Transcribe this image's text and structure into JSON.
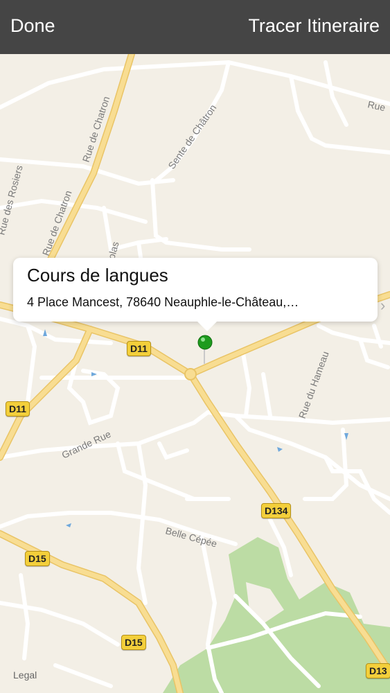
{
  "navbar": {
    "left_button": "Done",
    "right_button": "Tracer Itineraire"
  },
  "callout": {
    "title": "Cours de langues",
    "address": "4 Place Mancest, 78640 Neauphle-le-Château,…"
  },
  "streets": {
    "rue_top_right": "Rue",
    "sente_de_chatron": "Sente de Châtron",
    "rue_de_chatron_1": "Rue de Chatron",
    "rue_de_chatron_2": "Rue de Chatron",
    "rue_des_rosiers": "Rue des Rosiers",
    "nicolas": "olas",
    "rue_du_hameau": "Rue du Hameau",
    "grande_rue": "Grande Rue",
    "belle_cepee": "Belle Cépée"
  },
  "road_shields": {
    "d11_center": "D11",
    "d11_left": "D11",
    "d134": "D134",
    "d15_left": "D15",
    "d15_bottom": "D15",
    "d13_right": "D13"
  },
  "legal": "Legal",
  "colors": {
    "navbar": "#454545",
    "map_background": "#f3efe6",
    "main_road": "#f7d98a",
    "minor_road": "#ffffff",
    "park": "#b8d8a0",
    "pin": "#1e9b1e"
  },
  "icons": {
    "pin": "green-location-pin-icon",
    "disclosure": "chevron-right-icon"
  }
}
